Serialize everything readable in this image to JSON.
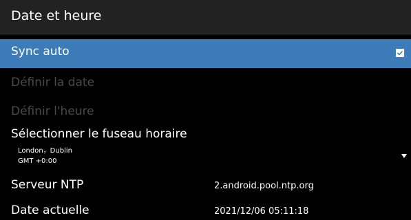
{
  "header": {
    "title": "Date et heure"
  },
  "menu": {
    "sync_auto": {
      "label": "Sync auto",
      "checked": true,
      "icon": "checkbox-checked-icon"
    },
    "set_date": {
      "label": "Définir la date",
      "enabled": false
    },
    "set_time": {
      "label": "Définir l'heure",
      "enabled": false
    },
    "timezone": {
      "label": "Sélectionner le fuseau horaire",
      "city": "London，Dublin",
      "offset": "GMT +0:00",
      "icon": "dropdown-arrow-icon"
    },
    "ntp_server": {
      "label": "Serveur NTP",
      "value": "2.android.pool.ntp.org"
    },
    "current_date": {
      "label": "Date actuelle",
      "value": "2021/12/06 05:11:18"
    }
  },
  "colors": {
    "background": "#000000",
    "header": "#222222",
    "selected": "#3d7cb8",
    "disabled_text": "#4a4a4a"
  }
}
